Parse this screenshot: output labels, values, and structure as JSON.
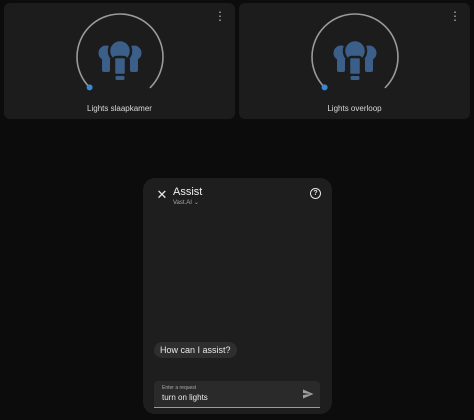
{
  "cards": [
    {
      "label": "Lights slaapkamer",
      "menu_icon": "more-vertical-icon",
      "icon": "lightbulb-group-icon",
      "accent": "#3a87d6",
      "bulb_color": "#3c5f8a"
    },
    {
      "label": "Lights overloop",
      "menu_icon": "more-vertical-icon",
      "icon": "lightbulb-group-icon",
      "accent": "#3a87d6",
      "bulb_color": "#3c5f8a"
    }
  ],
  "dialog": {
    "title": "Assist",
    "agent": "Vast.AI",
    "close_icon": "close-icon",
    "help_icon": "help-circle-icon",
    "message": "How can I assist?",
    "input": {
      "label": "Enter a request",
      "value": "turn on lights"
    },
    "send_icon": "send-icon"
  }
}
